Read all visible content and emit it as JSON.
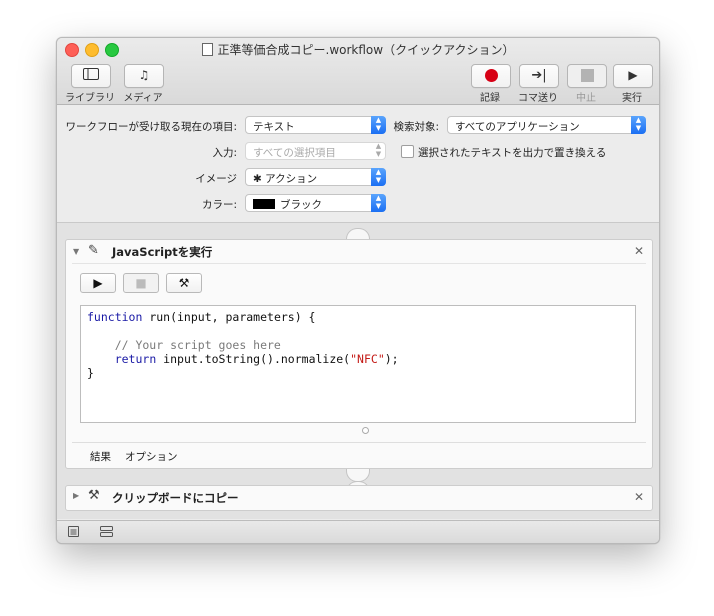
{
  "window": {
    "title": "正準等価合成コピー.workflow（クイックアクション）"
  },
  "toolbar": {
    "library_label": "ライブラリ",
    "media_label": "メディア",
    "record_label": "記録",
    "step_label": "コマ送り",
    "stop_label": "中止",
    "run_label": "実行"
  },
  "settings": {
    "receives_label": "ワークフローが受け取る現在の項目:",
    "receives_value": "テキスト",
    "in_label": "検索対象:",
    "in_value": "すべてのアプリケーション",
    "input_label": "入力:",
    "input_value": "すべての選択項目",
    "replace_label": "選択されたテキストを出力で置き換える",
    "image_label": "イメージ",
    "image_value": "アクション",
    "color_label": "カラー:",
    "color_value": "ブラック"
  },
  "actions": [
    {
      "title": "JavaScriptを実行",
      "code": {
        "line1_kw": "function",
        "line1_rest": " run(input, parameters) {",
        "line3": "    // Your script goes here",
        "line4_kw": "return",
        "line4_mid": " input.toString().normalize(",
        "line4_str": "\"NFC\"",
        "line4_end": ");",
        "line5": "}"
      },
      "tabs": [
        "結果",
        "オプション"
      ]
    },
    {
      "title": "クリップボードにコピー"
    }
  ],
  "colors": {
    "accent": "#1b6ff3",
    "record": "#d70015",
    "close": "#fe5f57",
    "minimize": "#febc2e",
    "maximize": "#28c840"
  },
  "icons": [
    "library-icon",
    "media-icon",
    "record-icon",
    "step-icon",
    "stop-icon",
    "run-icon",
    "gear-icon",
    "script-icon",
    "tools-icon",
    "list-view-icon",
    "flow-view-icon"
  ]
}
